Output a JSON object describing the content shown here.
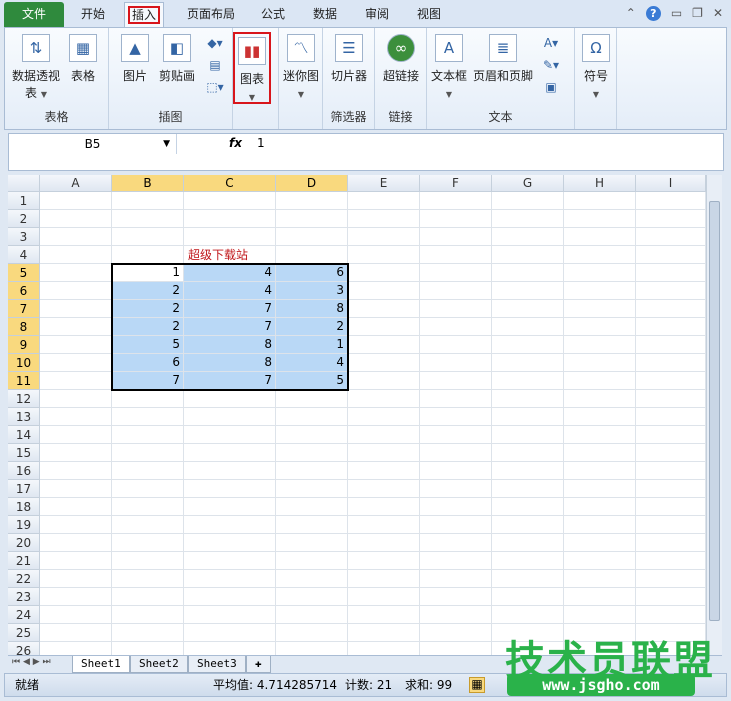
{
  "tabs": [
    {
      "label": "文件",
      "state": "file"
    },
    {
      "label": "开始"
    },
    {
      "label": "插入",
      "state": "active"
    },
    {
      "label": "页面布局"
    },
    {
      "label": "公式"
    },
    {
      "label": "数据"
    },
    {
      "label": "审阅"
    },
    {
      "label": "视图"
    }
  ],
  "ribbon": {
    "groups": [
      {
        "label": "表格",
        "buttons": [
          "数据透视表",
          "表格"
        ]
      },
      {
        "label": "插图",
        "buttons": [
          "图片",
          "剪贴画"
        ]
      },
      {
        "label": "",
        "buttons": [
          "图表"
        ]
      },
      {
        "label": "",
        "buttons": [
          "迷你图"
        ]
      },
      {
        "label": "筛选器",
        "buttons": [
          "切片器"
        ]
      },
      {
        "label": "链接",
        "buttons": [
          "超链接"
        ]
      },
      {
        "label": "文本",
        "buttons": [
          "文本框",
          "页眉和页脚"
        ]
      },
      {
        "label": "",
        "buttons": [
          "符号"
        ]
      }
    ]
  },
  "formula": {
    "name_box": "B5",
    "fx": "fx",
    "value": "1"
  },
  "columns": [
    "A",
    "B",
    "C",
    "D",
    "E",
    "F",
    "G",
    "H",
    "I"
  ],
  "rows": [
    "1",
    "2",
    "3",
    "4",
    "5",
    "6",
    "7",
    "8",
    "9",
    "10",
    "11",
    "12",
    "13",
    "14",
    "15",
    "16",
    "17",
    "18",
    "19",
    "20",
    "21",
    "22",
    "23",
    "24",
    "25",
    "26"
  ],
  "sheet_title": "超级下载站",
  "table": [
    [
      1,
      4,
      6
    ],
    [
      2,
      4,
      3
    ],
    [
      2,
      7,
      8
    ],
    [
      2,
      7,
      2
    ],
    [
      5,
      8,
      1
    ],
    [
      6,
      8,
      4
    ],
    [
      7,
      7,
      5
    ]
  ],
  "sheets": [
    "Sheet1",
    "Sheet2",
    "Sheet3"
  ],
  "status": {
    "ready": "就绪",
    "average": "平均值: 4.714285714",
    "count": "计数: 21",
    "sum": "求和: 99"
  },
  "watermark": {
    "text": "技术员联盟",
    "url": "www.jsgho.com"
  },
  "colors": {
    "file_tab": "#2f8a3d",
    "highlight": "#d8151b",
    "selection": "#b9d8f6",
    "header_selected": "#f9d97e"
  }
}
